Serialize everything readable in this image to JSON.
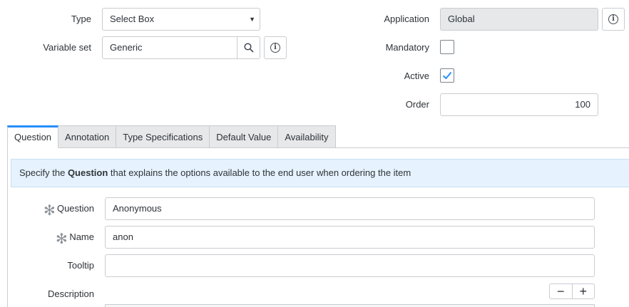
{
  "top": {
    "type_label": "Type",
    "type_value": "Select Box",
    "variable_set_label": "Variable set",
    "variable_set_value": "Generic",
    "application_label": "Application",
    "application_value": "Global",
    "mandatory_label": "Mandatory",
    "mandatory_checked": false,
    "active_label": "Active",
    "active_checked": true,
    "order_label": "Order",
    "order_value": "100"
  },
  "tabs": [
    {
      "label": "Question",
      "active": true
    },
    {
      "label": "Annotation",
      "active": false
    },
    {
      "label": "Type Specifications",
      "active": false
    },
    {
      "label": "Default Value",
      "active": false
    },
    {
      "label": "Availability",
      "active": false
    }
  ],
  "notice": {
    "pre": "Specify the ",
    "bold": "Question",
    "post": " that explains the options available to the end user when ordering the item"
  },
  "question_form": {
    "question_label": "Question",
    "question_value": "Anonymous",
    "name_label": "Name",
    "name_value": "anon",
    "tooltip_label": "Tooltip",
    "tooltip_value": "",
    "description_label": "Description"
  },
  "colors": {
    "accent": "#278efc",
    "notice_bg": "#e6f2fd",
    "readonly_bg": "#e6e8ea"
  }
}
